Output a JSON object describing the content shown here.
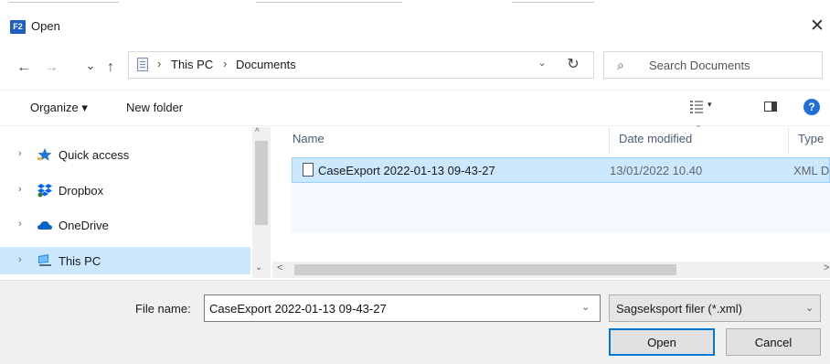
{
  "window": {
    "app_icon_text": "F2",
    "title": "Open",
    "close_glyph": "✕"
  },
  "nav": {
    "back_glyph": "←",
    "forward_glyph": "→",
    "recent_glyph": "⌄",
    "up_glyph": "↑",
    "address": {
      "crumbs": [
        "This PC",
        "Documents"
      ],
      "separator": "›",
      "dropdown_glyph": "⌄"
    },
    "refresh_glyph": "↻",
    "search": {
      "icon_glyph": "⌕",
      "placeholder": "Search Documents"
    }
  },
  "toolbar": {
    "organize_label": "Organize ▾",
    "new_folder_label": "New folder",
    "view_caret": "▾",
    "help_glyph": "?"
  },
  "sidebar": {
    "items": [
      {
        "label": "Quick access",
        "icon": "star-icon",
        "selected": false
      },
      {
        "label": "Dropbox",
        "icon": "dropbox-icon",
        "selected": false
      },
      {
        "label": "OneDrive",
        "icon": "cloud-icon",
        "selected": false
      },
      {
        "label": "This PC",
        "icon": "computer-icon",
        "selected": true
      }
    ],
    "chevron_glyph": "›",
    "scroll_up_glyph": "^",
    "scroll_down_glyph": "⌄"
  },
  "file_list": {
    "columns": [
      "Name",
      "Date modified",
      "Type"
    ],
    "sort_glyph": "⌄",
    "rows": [
      {
        "name": "CaseExport 2022-01-13 09-43-27",
        "date": "13/01/2022 10.40",
        "type": "XML D",
        "selected": true
      }
    ],
    "hscroll_left_glyph": "<",
    "hscroll_right_glyph": ">"
  },
  "bottom": {
    "file_name_label": "File name:",
    "file_name_value": "CaseExport 2022-01-13 09-43-27",
    "file_name_dropdown_glyph": "⌄",
    "file_type_value": "Sagseksport filer (*.xml)",
    "file_type_dropdown_glyph": "⌄",
    "open_label": "Open",
    "cancel_label": "Cancel"
  },
  "colors": {
    "accent": "#0078d7",
    "selection": "#cce8ff",
    "selection_border": "#99d1ff",
    "help_blue": "#1e6fd9",
    "app_icon_blue": "#1f5fbf"
  }
}
